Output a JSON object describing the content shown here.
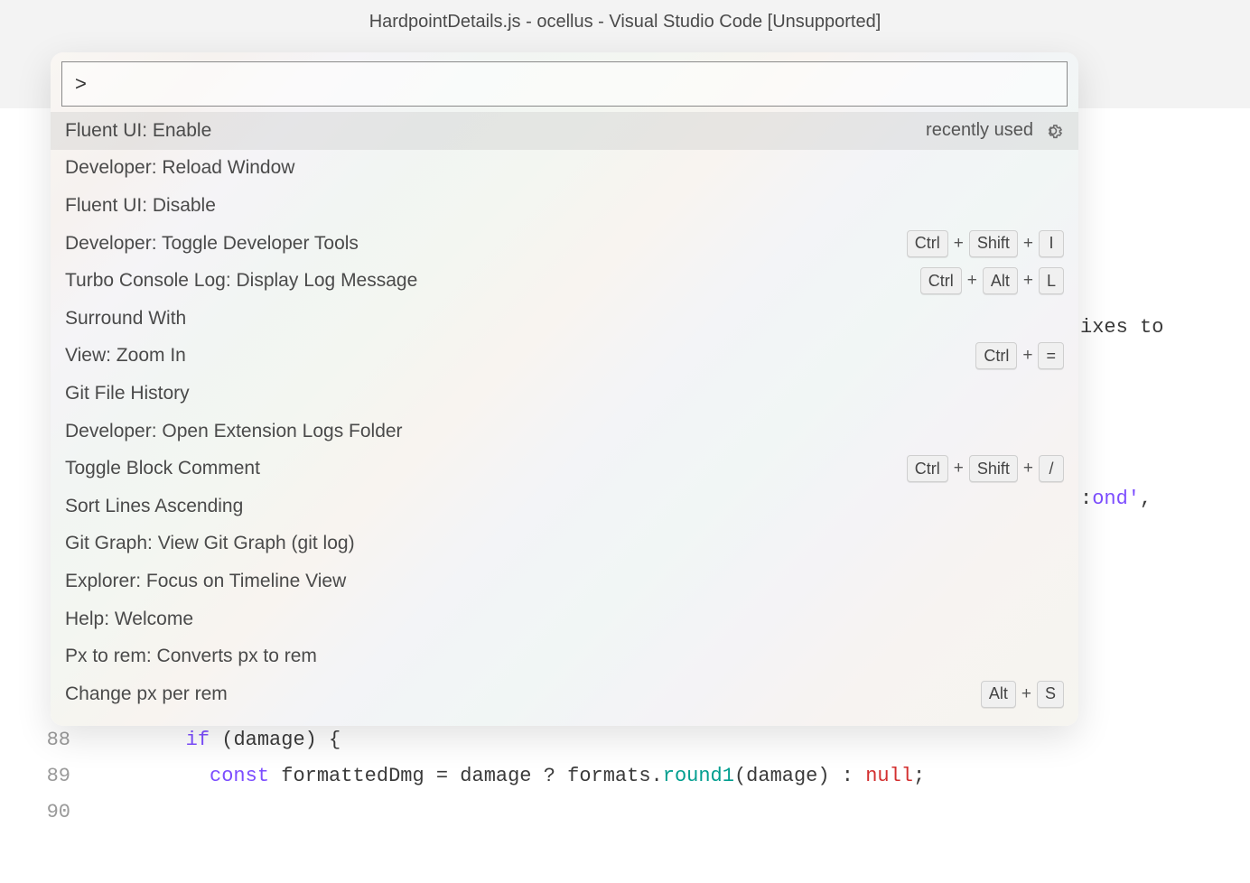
{
  "window": {
    "title": "HardpointDetails.js - ocellus - Visual Studio Code [Unsupported]"
  },
  "palette": {
    "input_value": ">",
    "recently_used_label": "recently used",
    "items": [
      {
        "label": "Fluent UI: Enable",
        "selected": true,
        "recently_used": true,
        "shortcut": []
      },
      {
        "label": "Developer: Reload Window",
        "shortcut": []
      },
      {
        "label": "Fluent UI: Disable",
        "shortcut": []
      },
      {
        "label": "Developer: Toggle Developer Tools",
        "shortcut": [
          "Ctrl",
          "Shift",
          "I"
        ]
      },
      {
        "label": "Turbo Console Log: Display Log Message",
        "shortcut": [
          "Ctrl",
          "Alt",
          "L"
        ]
      },
      {
        "label": "Surround With",
        "shortcut": []
      },
      {
        "label": "View: Zoom In",
        "shortcut": [
          "Ctrl",
          "="
        ]
      },
      {
        "label": "Git File History",
        "shortcut": []
      },
      {
        "label": "Developer: Open Extension Logs Folder",
        "shortcut": []
      },
      {
        "label": "Toggle Block Comment",
        "shortcut": [
          "Ctrl",
          "Shift",
          "/"
        ]
      },
      {
        "label": "Sort Lines Ascending",
        "shortcut": []
      },
      {
        "label": "Git Graph: View Git Graph (git log)",
        "shortcut": []
      },
      {
        "label": "Explorer: Focus on Timeline View",
        "shortcut": []
      },
      {
        "label": "Help: Welcome",
        "shortcut": []
      },
      {
        "label": "Px to rem: Converts px to rem",
        "shortcut": []
      },
      {
        "label": "Change px per rem",
        "shortcut": [
          "Alt",
          "S"
        ]
      }
    ]
  },
  "editor": {
    "overflow1": "ixes to",
    "overflow2": ":ond',",
    "lines": [
      {
        "num": "88",
        "tokens": [
          {
            "cls": "indent",
            "t": "        "
          },
          {
            "cls": "tok-kw",
            "t": "if"
          },
          {
            "cls": "tok-punc",
            "t": " ("
          },
          {
            "cls": "tok-ident",
            "t": "damage"
          },
          {
            "cls": "tok-punc",
            "t": ") {"
          }
        ]
      },
      {
        "num": "89",
        "tokens": [
          {
            "cls": "indent",
            "t": "          "
          },
          {
            "cls": "tok-kw",
            "t": "const"
          },
          {
            "cls": "tok-ident",
            "t": " formattedDmg "
          },
          {
            "cls": "tok-op",
            "t": "="
          },
          {
            "cls": "tok-ident",
            "t": " damage "
          },
          {
            "cls": "tok-op",
            "t": "?"
          },
          {
            "cls": "tok-ident",
            "t": " formats"
          },
          {
            "cls": "tok-punc",
            "t": "."
          },
          {
            "cls": "tok-func",
            "t": "round1"
          },
          {
            "cls": "tok-punc",
            "t": "("
          },
          {
            "cls": "tok-ident",
            "t": "damage"
          },
          {
            "cls": "tok-punc",
            "t": ") "
          },
          {
            "cls": "tok-op",
            "t": ":"
          },
          {
            "cls": "tok-ident",
            "t": " "
          },
          {
            "cls": "tok-null",
            "t": "null"
          },
          {
            "cls": "tok-punc",
            "t": ";"
          }
        ]
      },
      {
        "num": "90",
        "tokens": []
      }
    ]
  }
}
